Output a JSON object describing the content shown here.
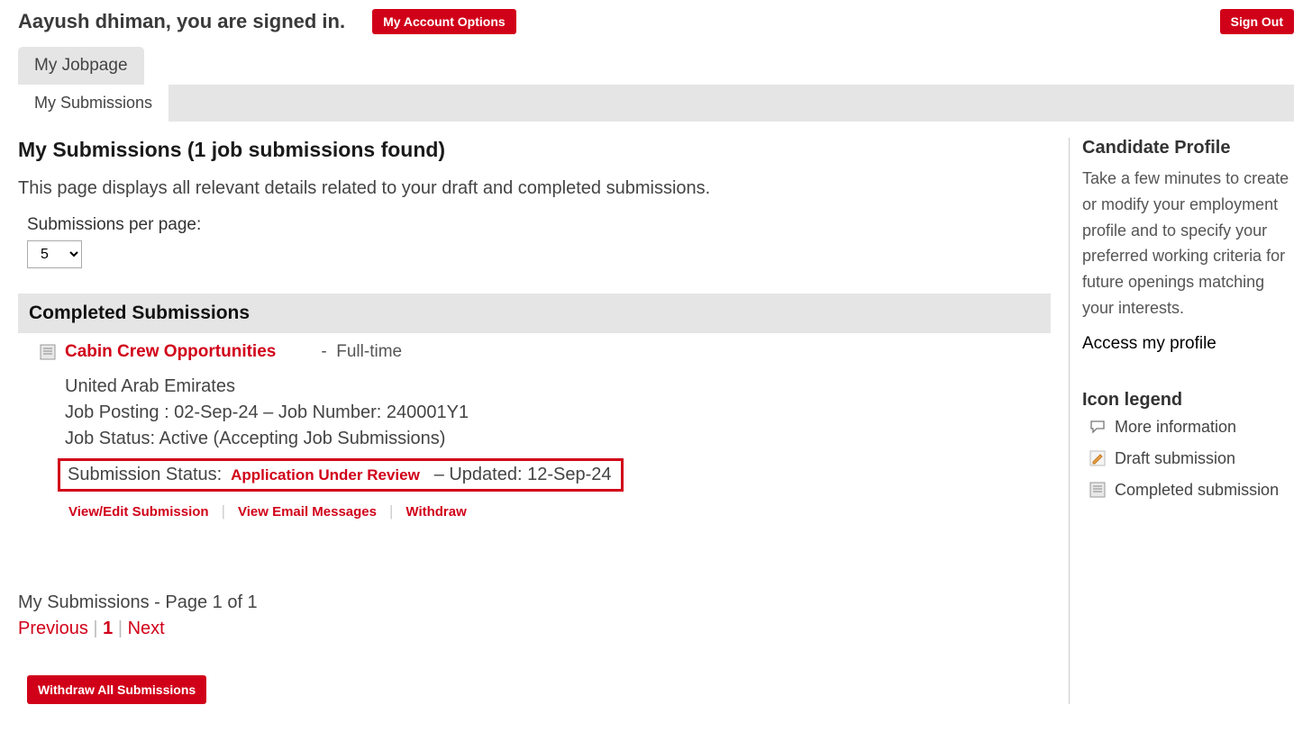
{
  "header": {
    "signed_in_text": "Aayush dhiman, you are signed in.",
    "account_options_label": "My Account Options",
    "sign_out_label": "Sign Out"
  },
  "tabs": {
    "jobpage_label": "My Jobpage",
    "submissions_label": "My Submissions"
  },
  "page": {
    "title": "My Submissions (1 job submissions found)",
    "description": "This page displays all relevant details related to your draft and completed submissions.",
    "per_page_label": "Submissions per page:",
    "per_page_value": "5",
    "section_header": "Completed Submissions"
  },
  "submission": {
    "job_title": "Cabin Crew Opportunities",
    "job_type_sep": "-",
    "job_type": "Full-time",
    "location": "United Arab Emirates",
    "posting_line": "Job Posting : 02-Sep-24 – Job Number: 240001Y1",
    "status_line": "Job Status: Active (Accepting Job Submissions)",
    "sub_status_label": "Submission Status:",
    "sub_status_value": "Application Under Review",
    "updated_text": "– Updated: 12-Sep-24",
    "actions": {
      "view_edit": "View/Edit Submission",
      "email": "View Email Messages",
      "withdraw": "Withdraw"
    }
  },
  "pager": {
    "summary": "My Submissions - Page 1 of 1",
    "previous": "Previous",
    "current": "1",
    "next": "Next"
  },
  "withdraw_all_label": "Withdraw All Submissions",
  "sidebar": {
    "profile_heading": "Candidate Profile",
    "profile_text": "Take a few minutes to create or modify your employment profile and to specify your preferred working criteria for future openings matching your interests.",
    "profile_link": "Access my profile",
    "legend_heading": "Icon legend",
    "legend": {
      "more_info": "More information",
      "draft": "Draft submission",
      "completed": "Completed submission"
    }
  }
}
